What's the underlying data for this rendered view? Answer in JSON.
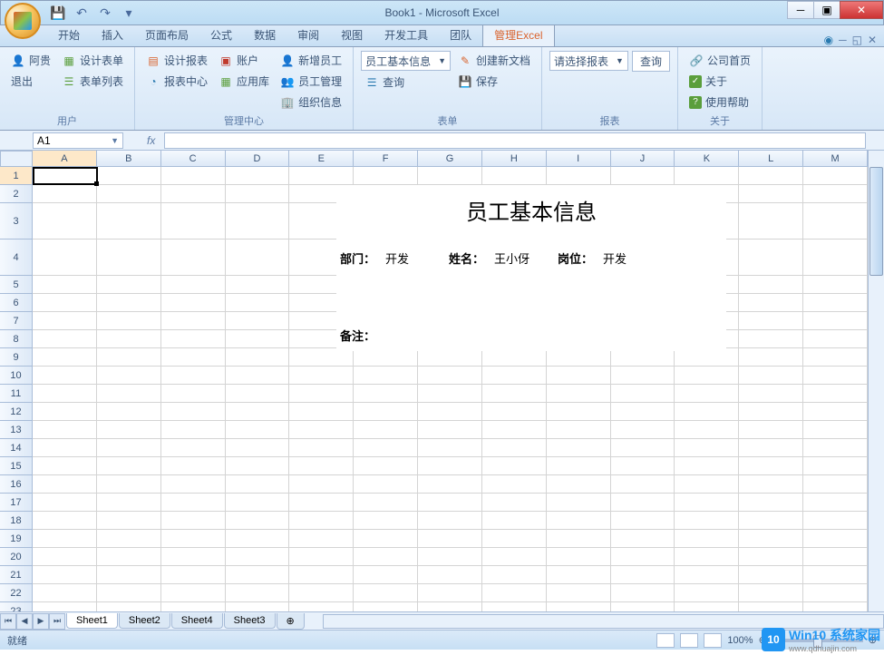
{
  "window": {
    "title": "Book1 - Microsoft Excel"
  },
  "qat": {
    "save": "💾",
    "undo": "↶",
    "redo": "↷"
  },
  "tabs": {
    "items": [
      "开始",
      "插入",
      "页面布局",
      "公式",
      "数据",
      "审阅",
      "视图",
      "开发工具",
      "团队",
      "管理Excel"
    ],
    "active": "管理Excel"
  },
  "ribbon": {
    "groups": [
      {
        "label": "用户",
        "items": [
          {
            "icon": "👤",
            "label": "阿贵",
            "color": "#d9632d"
          },
          {
            "icon": "",
            "label": "退出"
          },
          {
            "icon": "📋",
            "label": "设计表单",
            "color": "#5a9e3c"
          },
          {
            "icon": "📃",
            "label": "表单列表",
            "color": "#5a9e3c"
          }
        ]
      },
      {
        "label": "管理中心",
        "items": [
          {
            "icon": "📊",
            "label": "设计报表",
            "color": "#d9632d"
          },
          {
            "icon": "📈",
            "label": "报表中心",
            "color": "#2a7ab0"
          },
          {
            "icon": "👛",
            "label": "账户",
            "color": "#c0392b"
          },
          {
            "icon": "🗂",
            "label": "应用库",
            "color": "#5a9e3c"
          },
          {
            "icon": "👤",
            "label": "新增员工",
            "color": "#2a7ab0"
          },
          {
            "icon": "👥",
            "label": "员工管理",
            "color": "#d9632d"
          },
          {
            "icon": "🏢",
            "label": "组织信息",
            "color": "#2a7ab0"
          }
        ]
      },
      {
        "label": "表单",
        "combo": "员工基本信息",
        "items": [
          {
            "icon": "🔍",
            "label": "查询"
          },
          {
            "icon": "📄",
            "label": "创建新文档",
            "color": "#d9632d"
          },
          {
            "icon": "💾",
            "label": "保存",
            "color": "#2a7ab0"
          }
        ]
      },
      {
        "label": "报表",
        "combo": "请选择报表",
        "items": [
          {
            "icon": "",
            "label": "查询"
          }
        ]
      },
      {
        "label": "关于",
        "items": [
          {
            "icon": "🔗",
            "label": "公司首页",
            "color": "#2a7ab0"
          },
          {
            "icon": "ℹ",
            "label": "关于",
            "color": "#5a9e3c"
          },
          {
            "icon": "❓",
            "label": "使用帮助",
            "color": "#5a9e3c"
          }
        ]
      }
    ]
  },
  "formula": {
    "cell_ref": "A1",
    "fx": "fx"
  },
  "grid": {
    "columns": [
      "A",
      "B",
      "C",
      "D",
      "E",
      "F",
      "G",
      "H",
      "I",
      "J",
      "K",
      "L",
      "M"
    ],
    "rows": 23
  },
  "overlay": {
    "title": "员工基本信息",
    "dept_label": "部门：",
    "dept_value": "开发",
    "name_label": "姓名：",
    "name_value": "王小伢",
    "post_label": "岗位：",
    "post_value": "开发",
    "remark_label": "备注："
  },
  "sheets": {
    "tabs": [
      "Sheet1",
      "Sheet2",
      "Sheet4",
      "Sheet3"
    ],
    "active": "Sheet1"
  },
  "status": {
    "ready": "就绪",
    "zoom": "100%"
  },
  "watermark": {
    "brand": "Win10 系统家园",
    "url": "www.qdhuajin.com",
    "icon": "10"
  }
}
